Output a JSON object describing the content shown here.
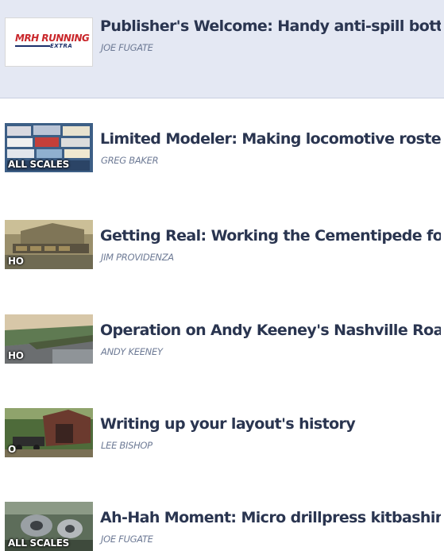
{
  "articles": [
    {
      "title": "Publisher's Welcome: Handy anti-spill bottle holders",
      "author": "JOE FUGATE",
      "thumb_icon": "mrh-running-extra-logo",
      "logo": {
        "main": "MRH RUNNING",
        "sub": "EXTRA"
      },
      "badge": ""
    },
    {
      "title": "Limited Modeler: Making locomotive roster decisions",
      "author": "GREG BAKER",
      "thumb_icon": "locomotive-boxes-photo",
      "badge": "ALL SCALES"
    },
    {
      "title": "Getting Real: Working the Cementipede for the win",
      "author": "JIM PROVIDENZA",
      "thumb_icon": "cement-plant-layout-photo",
      "badge": "HO"
    },
    {
      "title": "Operation on Andy Keeney's Nashville Road",
      "author": "ANDY KEENEY",
      "thumb_icon": "layout-aisle-photo",
      "badge": "HO"
    },
    {
      "title": "Writing up your layout's history",
      "author": "LEE BISHOP",
      "thumb_icon": "covered-bridge-photo",
      "badge": "O"
    },
    {
      "title": "Ah-Hah Moment: Micro drillpress kitbashing",
      "author": "JOE FUGATE",
      "thumb_icon": "drillpress-photo",
      "badge": "ALL SCALES"
    }
  ],
  "colors": {
    "featured_background": "#e4e8f3",
    "title_text": "#2a3550",
    "author_text": "#6d7a95",
    "logo_red": "#c9272b",
    "logo_blue": "#1c2f6a"
  }
}
